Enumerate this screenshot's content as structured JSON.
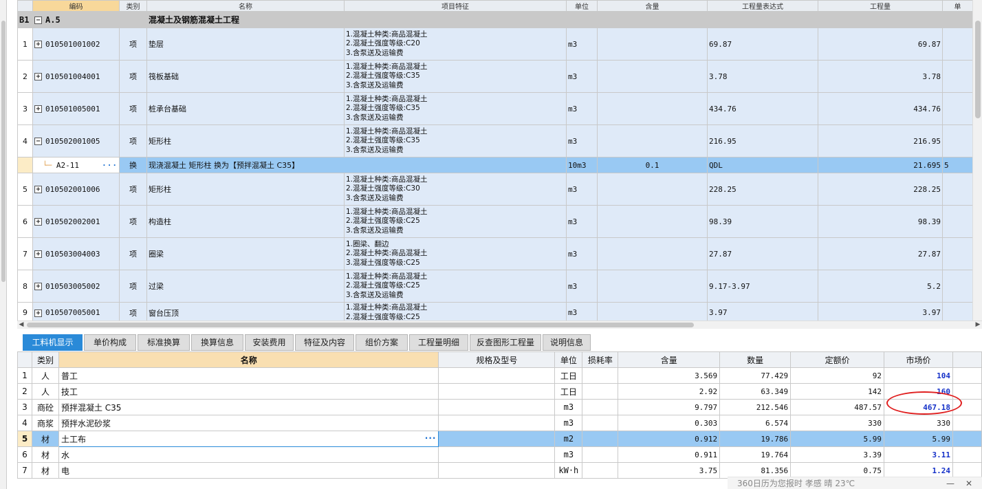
{
  "upper": {
    "headers": [
      "编码",
      "类别",
      "名称",
      "项目特征",
      "单位",
      "含量",
      "工程量表达式",
      "工程量",
      "单"
    ],
    "chapter": {
      "num": "B1",
      "code": "A.5",
      "name": "混凝土及钢筋混凝土工程"
    },
    "rows": [
      {
        "num": "1",
        "code": "010501001002",
        "type": "项",
        "name": "垫层",
        "features": [
          "1.混凝土种类:商品混凝土",
          "2.混凝土强度等级:C20",
          "3.含泵送及运输费"
        ],
        "unit": "m3",
        "qty_expr": "69.87",
        "qty": "69.87",
        "sign": "+"
      },
      {
        "num": "2",
        "code": "010501004001",
        "type": "项",
        "name": "筏板基础",
        "features": [
          "1.混凝土种类:商品混凝土",
          "2.混凝土强度等级:C35",
          "3.含泵送及运输费"
        ],
        "unit": "m3",
        "qty_expr": "3.78",
        "qty": "3.78",
        "sign": "+"
      },
      {
        "num": "3",
        "code": "010501005001",
        "type": "项",
        "name": "桩承台基础",
        "features": [
          "1.混凝土种类:商品混凝土",
          "2.混凝土强度等级:C35",
          "3.含泵送及运输费"
        ],
        "unit": "m3",
        "qty_expr": "434.76",
        "qty": "434.76",
        "sign": "+"
      },
      {
        "num": "4",
        "code": "010502001005",
        "type": "项",
        "name": "矩形柱",
        "features": [
          "1.混凝土种类:商品混凝土",
          "2.混凝土强度等级:C35",
          "3.含泵送及运输费"
        ],
        "unit": "m3",
        "qty_expr": "216.95",
        "qty": "216.95",
        "sign": "−"
      },
      {
        "num": "5",
        "code": "010502001006",
        "type": "项",
        "name": "矩形柱",
        "features": [
          "1.混凝土种类:商品混凝土",
          "2.混凝土强度等级:C30",
          "3.含泵送及运输费"
        ],
        "unit": "m3",
        "qty_expr": "228.25",
        "qty": "228.25",
        "sign": "+"
      },
      {
        "num": "6",
        "code": "010502002001",
        "type": "项",
        "name": "构造柱",
        "features": [
          "1.混凝土种类:商品混凝土",
          "2.混凝土强度等级:C25",
          "3.含泵送及运输费"
        ],
        "unit": "m3",
        "qty_expr": "98.39",
        "qty": "98.39",
        "sign": "+"
      },
      {
        "num": "7",
        "code": "010503004003",
        "type": "项",
        "name": "圈梁",
        "features": [
          "1.圈梁、翻边",
          "2.混凝土种类:商品混凝土",
          "3.混凝土强度等级:C25"
        ],
        "unit": "m3",
        "qty_expr": "27.87",
        "qty": "27.87",
        "sign": "+"
      },
      {
        "num": "8",
        "code": "010503005002",
        "type": "项",
        "name": "过梁",
        "features": [
          "1.混凝土种类:商品混凝土",
          "2.混凝土强度等级:C25",
          "3.含泵送及运输费"
        ],
        "unit": "m3",
        "qty_expr": "9.17-3.97",
        "qty": "5.2",
        "sign": "+"
      },
      {
        "num": "9",
        "code": "010507005001",
        "type": "项",
        "name": "窗台压顶",
        "features": [
          "1.混凝土种类:商品混凝土",
          "2.混凝土强度等级:C25"
        ],
        "unit": "m3",
        "qty_expr": "3.97",
        "qty": "3.97",
        "sign": "+"
      }
    ],
    "sub": {
      "code": "A2-11",
      "type": "换",
      "name": "现浇混凝土 矩形柱  换为【预拌混凝土 C35】",
      "unit": "10m3",
      "content": "0.1",
      "qty_expr": "QDL",
      "qty": "21.695",
      "extra": "5"
    }
  },
  "tabs": [
    "工料机显示",
    "单价构成",
    "标准换算",
    "换算信息",
    "安装费用",
    "特征及内容",
    "组价方案",
    "工程量明细",
    "反查图形工程量",
    "说明信息"
  ],
  "lower": {
    "headers": [
      "",
      "类别",
      "名称",
      "规格及型号",
      "单位",
      "损耗率",
      "含量",
      "数量",
      "定额价",
      "市场价"
    ],
    "rows": [
      {
        "num": "1",
        "cat": "人",
        "name": "普工",
        "spec": "",
        "unit": "工日",
        "loss": "",
        "content": "3.569",
        "qty": "77.429",
        "quota": "92",
        "market": "104",
        "blue": true
      },
      {
        "num": "2",
        "cat": "人",
        "name": "技工",
        "spec": "",
        "unit": "工日",
        "loss": "",
        "content": "2.92",
        "qty": "63.349",
        "quota": "142",
        "market": "160",
        "blue": true
      },
      {
        "num": "3",
        "cat": "商砼",
        "name": "预拌混凝土 C35",
        "spec": "",
        "unit": "m3",
        "loss": "",
        "content": "9.797",
        "qty": "212.546",
        "quota": "487.57",
        "market": "467.18",
        "blue": true
      },
      {
        "num": "4",
        "cat": "商浆",
        "name": "预拌水泥砂浆",
        "spec": "",
        "unit": "m3",
        "loss": "",
        "content": "0.303",
        "qty": "6.574",
        "quota": "330",
        "market": "330",
        "blue": false
      },
      {
        "num": "5",
        "cat": "材",
        "name": "土工布",
        "spec": "",
        "unit": "m2",
        "loss": "",
        "content": "0.912",
        "qty": "19.786",
        "quota": "5.99",
        "market": "5.99",
        "blue": false,
        "selected": true
      },
      {
        "num": "6",
        "cat": "材",
        "name": "水",
        "spec": "",
        "unit": "m3",
        "loss": "",
        "content": "0.911",
        "qty": "19.764",
        "quota": "3.39",
        "market": "3.11",
        "blue": true
      },
      {
        "num": "7",
        "cat": "材",
        "name": "电",
        "spec": "",
        "unit": "kW·h",
        "loss": "",
        "content": "3.75",
        "qty": "81.356",
        "quota": "0.75",
        "market": "1.24",
        "blue": true
      }
    ]
  },
  "weather": "360日历为您报时 孝感 晴 23℃"
}
